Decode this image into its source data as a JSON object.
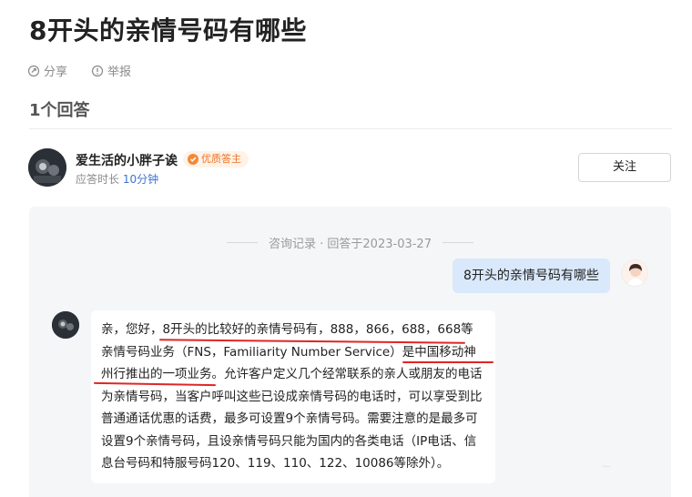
{
  "question": {
    "title": "8开头的亲情号码有哪些"
  },
  "actions": {
    "share_label": "分享",
    "report_label": "举报"
  },
  "answers": {
    "count_label": "1个回答"
  },
  "answerer": {
    "name": "爱生活的小胖子诶",
    "badge": "优质答主",
    "response_prefix": "应答时长",
    "response_value": "10分钟",
    "follow_label": "关注"
  },
  "chat": {
    "record_label": "咨询记录 · 回答于2023-03-27",
    "user_message": "8开头的亲情号码有哪些",
    "answer_part1": "亲，您好，",
    "answer_part2": "8开头的比较好的亲情号码有，888，866，688，668",
    "answer_part3": "等亲情号码业务（FNS，Familiarity Number Service）",
    "answer_part4": "是中国移动神州行推出的一项业务",
    "answer_part5": "。允许客户定义几个经常联系的亲人或朋友的电话为亲情号码，当客户呼叫这些已设成亲情号码的电话时，可以享受到比普通通话优惠的话费，最多可设置9个亲情号码。需要注意的是最多可设置9个亲情号码，且设亲情号码只能为国内的各类电话（IP电话、信息台号码和特服号码120、119、110、122、10086等除外）。"
  },
  "colors": {
    "accent_blue": "#3f73d8",
    "badge_orange": "#e8752a",
    "bubble_blue": "#d9e8fb",
    "annotation_red": "#e02525"
  }
}
